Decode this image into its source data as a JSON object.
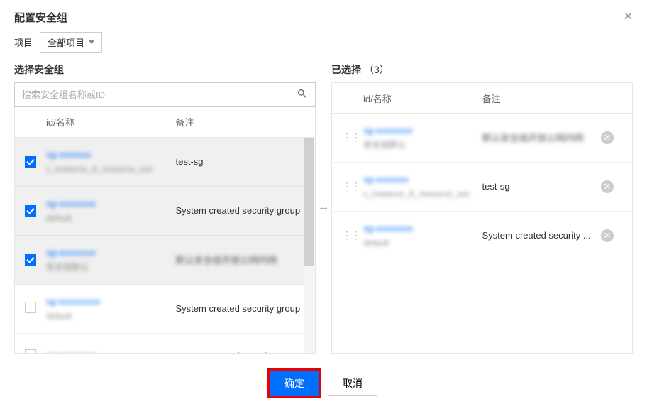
{
  "dialog": {
    "title": "配置安全组",
    "close": "×"
  },
  "project": {
    "label": "项目",
    "selected": "全部项目"
  },
  "left": {
    "title": "选择安全组",
    "search_placeholder": "搜索安全组名称或ID",
    "col_id": "id/名称",
    "col_remark": "备注",
    "rows": [
      {
        "id": "sg-xxxxxxx",
        "name": "x_instance_A_resource_xxx",
        "remark": "test-sg",
        "checked": true,
        "remark_blur": false
      },
      {
        "id": "sg-xxxxxxxx",
        "name": "default",
        "remark": "System created security group",
        "checked": true,
        "remark_blur": false
      },
      {
        "id": "sg-xxxxxxxx",
        "name": "安全组默认",
        "remark": "默认安全组开放公网内网",
        "checked": true,
        "remark_blur": true
      },
      {
        "id": "sg-xxxxxxxxx",
        "name": "default",
        "remark": "System created security group",
        "checked": false,
        "remark_blur": false
      },
      {
        "id": "sg-xxxxxxxx",
        "name": "",
        "remark": "System created security group",
        "checked": false,
        "remark_blur": false
      }
    ]
  },
  "right": {
    "title": "已选择",
    "count": "（3）",
    "col_id": "id/名称",
    "col_remark": "备注",
    "rows": [
      {
        "id": "sg-xxxxxxxx",
        "name": "安全组默认",
        "remark": "默认安全组开放公网内网",
        "remark_blur": true
      },
      {
        "id": "sg-xxxxxxx",
        "name": "x_instance_A_resource_xxx",
        "remark": "test-sg",
        "remark_blur": false
      },
      {
        "id": "sg-xxxxxxxx",
        "name": "default",
        "remark": "System created security ...",
        "remark_blur": false
      }
    ]
  },
  "footer": {
    "confirm": "确定",
    "cancel": "取消"
  },
  "transfer_icon": "↔"
}
